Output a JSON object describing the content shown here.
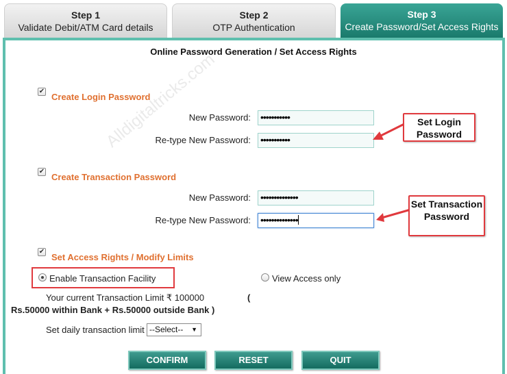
{
  "tabs": [
    {
      "step": "Step 1",
      "label": "Validate Debit/ATM Card details"
    },
    {
      "step": "Step 2",
      "label": "OTP Authentication"
    },
    {
      "step": "Step 3",
      "label": "Create Password/Set Access Rights"
    }
  ],
  "heading": "Online Password Generation / Set Access Rights",
  "login": {
    "title": "Create Login Password",
    "new_label": "New Password:",
    "new_value": "•••••••••••",
    "retype_label": "Re-type New Password:",
    "retype_value": "•••••••••••",
    "callout": "Set Login Password"
  },
  "transaction": {
    "title": "Create Transaction Password",
    "new_label": "New Password:",
    "new_value": "••••••••••••••",
    "retype_label": "Re-type New Password:",
    "retype_value": "••••••••••••••",
    "callout": "Set Transaction Password"
  },
  "access": {
    "title": "Set Access Rights / Modify Limits",
    "enable_label": "Enable Transaction Facility",
    "view_label": "View Access only",
    "limit_text": "Your current Transaction Limit ₹ 100000",
    "limit_paren": "(",
    "limit_detail": "Rs.50000 within Bank + Rs.50000 outside Bank )",
    "daily_label": "Set daily transaction limit",
    "daily_select": "--Select--"
  },
  "buttons": {
    "confirm": "CONFIRM",
    "reset": "RESET",
    "quit": "QUIT"
  },
  "watermark": "Alldigitaltricks.com",
  "colors": {
    "accent": "#5fbfae",
    "orange": "#e07030",
    "callout_border": "#e0393d"
  }
}
